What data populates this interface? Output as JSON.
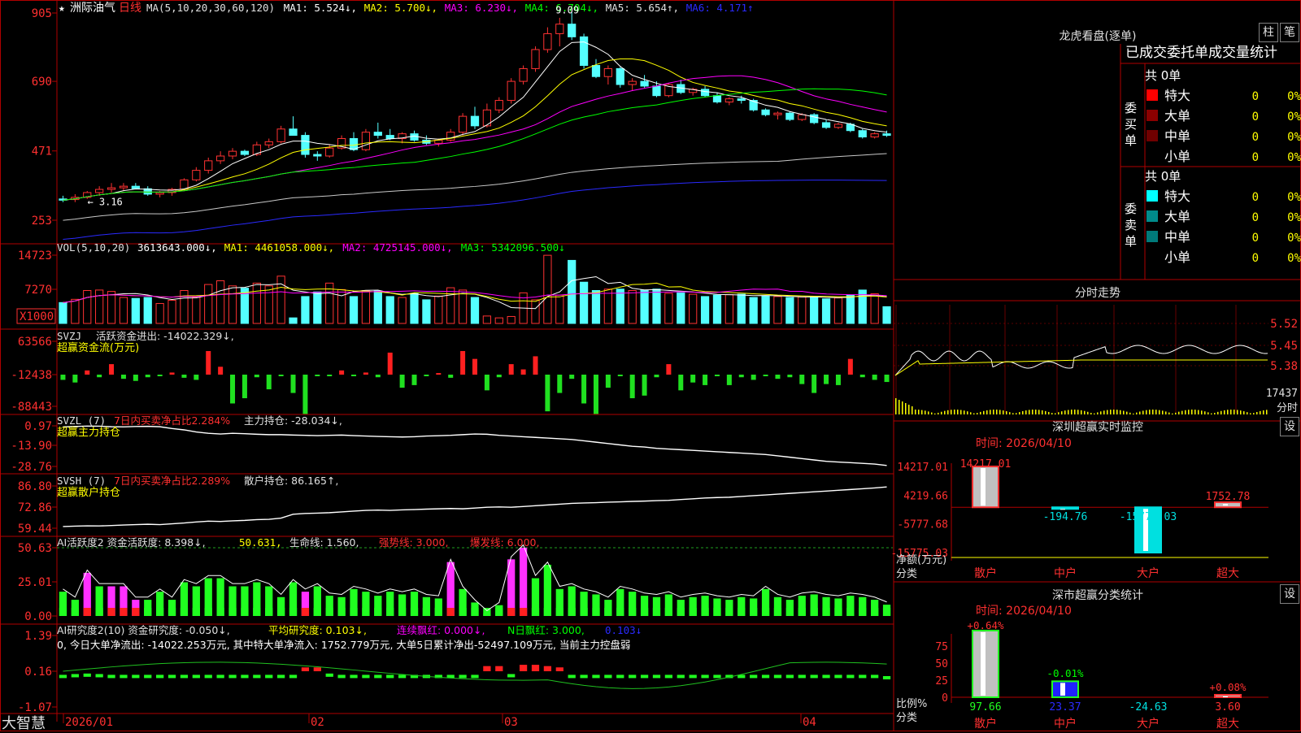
{
  "stock": {
    "star": "★",
    "name": "洲际油气",
    "period": "日线"
  },
  "ma_line": [
    {
      "t": "MA(5,10,20,30,60,120)",
      "c": "#e0e0e0"
    },
    {
      "t": "MA1: 5.524↓,",
      "c": "#ffffff"
    },
    {
      "t": "MA2: 5.700↓,",
      "c": "#ffff00"
    },
    {
      "t": "MA3: 6.230↓,",
      "c": "#ff00ff"
    },
    {
      "t": "MA4: 6.704↓,",
      "c": "#00ff00"
    },
    {
      "t": "MA5: 5.654↑,",
      "c": "#e0e0e0"
    },
    {
      "t": "MA6: 4.171↑",
      "c": "#2a2aff"
    }
  ],
  "price_axis": [
    "905",
    "690",
    "471",
    "253"
  ],
  "price_marks": {
    "high": "9.09",
    "low": "3.16"
  },
  "vol_line": [
    {
      "t": "VOL(5,10,20)",
      "c": "#e0e0e0"
    },
    {
      "t": "3613643.000↓,",
      "c": "#ffffff"
    },
    {
      "t": "MA1: 4461058.000↓,",
      "c": "#ffff00"
    },
    {
      "t": "MA2: 4725145.000↓,",
      "c": "#ff00ff"
    },
    {
      "t": "MA3: 5342096.500↓",
      "c": "#00ff00"
    }
  ],
  "vol_axis": [
    "14723",
    "7270"
  ],
  "vol_unit": "X1000",
  "svzj": {
    "l1": "SVZJ",
    "l2": "活跃资金进出: -14022.329↓,",
    "l3": "超赢资金流(万元)",
    "axis": [
      "63566",
      "-12438",
      "-88443"
    ]
  },
  "svzl": {
    "l1": "SVZL (7)",
    "l2": "7日内买卖净占比2.284%",
    "l3": "主力持仓: -28.034↓,",
    "l4": "超赢主力持仓",
    "axis": [
      "0.97",
      "-13.90",
      "-28.76"
    ]
  },
  "svsh": {
    "l1": "SVSH (7)",
    "l2": "7日内买卖净占比2.289%",
    "l3": "散户持仓: 86.165↑,",
    "l4": "超赢散户持仓",
    "axis": [
      "86.80",
      "72.86",
      "59.44"
    ]
  },
  "ai1": {
    "l1": "AI活跃度2 资金活跃度: 8.398↓,",
    "l2": "50.631,",
    "l3": "生命线: 1.560,",
    "l4": "强势线: 3.000,",
    "l5": "爆发线: 6.000,",
    "axis": [
      "50.63",
      "25.01",
      "0.00"
    ]
  },
  "ai2": {
    "l1": "AI研究度2(10) 资金研究度: -0.050↓,",
    "l2": "平均研究度: 0.103↓,",
    "l3": "连续飘红: 0.000↓,",
    "l4": "N日飘红: 3.000,",
    "l5": "0.103↓",
    "note": "0, 今日大单净流出: -14022.253万元, 其中特大单净流入: 1752.779万元, 大单5日累计净出-52497.109万元, 当前主力控盘弱",
    "axis": [
      "1.39",
      "0.16",
      "-1.07"
    ]
  },
  "date_axis": [
    "2026/01",
    "02",
    "03",
    "04"
  ],
  "logo": "大智慧",
  "lhb": {
    "title": "龙虎看盘(逐单)",
    "btn1": "柱",
    "btn2": "笔",
    "header": "已成交委托单成交量统计",
    "buy": {
      "side": "委买单",
      "count": "共 0单",
      "rows": [
        {
          "n": "特大",
          "v": "0",
          "p": "0%",
          "c": "#ff0000"
        },
        {
          "n": "大单",
          "v": "0",
          "p": "0%",
          "c": "#8b0000"
        },
        {
          "n": "中单",
          "v": "0",
          "p": "0%",
          "c": "#700000"
        },
        {
          "n": "小单",
          "v": "0",
          "p": "0%",
          "c": ""
        }
      ]
    },
    "sell": {
      "side": "委卖单",
      "count": "共 0单",
      "rows": [
        {
          "n": "特大",
          "v": "0",
          "p": "0%",
          "c": "#00ffff"
        },
        {
          "n": "大单",
          "v": "0",
          "p": "0%",
          "c": "#008b8b"
        },
        {
          "n": "中单",
          "v": "0",
          "p": "0%",
          "c": "#007a7a"
        },
        {
          "n": "小单",
          "v": "0",
          "p": "0%",
          "c": ""
        }
      ]
    }
  },
  "intraday": {
    "title": "分时走势",
    "axis": [
      "5.52",
      "5.45",
      "5.38"
    ],
    "vol": "17437",
    "vol_unit": "分时"
  },
  "monitor": {
    "title": "深圳超赢实时监控",
    "btn": "设",
    "time": "时间: 2026/04/10",
    "axis": [
      "14217.01",
      "4219.66",
      "-5777.68",
      "-15775.03"
    ],
    "unit1": "净额(万元)",
    "unit2": "分类",
    "cats": [
      "散户",
      "中户",
      "大户",
      "超大"
    ],
    "labels": [
      "14217.01",
      "-194.76",
      "-15775.03",
      "1752.78"
    ]
  },
  "stats": {
    "title": "深市超赢分类统计",
    "btn": "设",
    "time": "时间: 2026/04/10",
    "axis": [
      "75",
      "50",
      "25",
      "0"
    ],
    "unit1": "比例%",
    "unit2": "分类",
    "cats": [
      "散户",
      "中户",
      "大户",
      "超大"
    ],
    "top": [
      "+0.64%",
      "-0.01%",
      "",
      "+0.08%"
    ],
    "bottom": [
      "97.66",
      "23.37",
      "-24.63",
      "3.60"
    ]
  },
  "chart_data": [
    {
      "type": "candlestick",
      "title": "洲际油气 日线",
      "ylim": [
        2.53,
        9.05
      ],
      "x_ticks": [
        "2026/01",
        "02",
        "03",
        "04"
      ],
      "ohlc": [
        [
          3.2,
          3.3,
          3.1,
          3.16
        ],
        [
          3.18,
          3.35,
          3.1,
          3.25
        ],
        [
          3.25,
          3.45,
          3.2,
          3.4
        ],
        [
          3.4,
          3.6,
          3.3,
          3.5
        ],
        [
          3.5,
          3.7,
          3.4,
          3.55
        ],
        [
          3.55,
          3.7,
          3.45,
          3.6
        ],
        [
          3.6,
          3.7,
          3.5,
          3.52
        ],
        [
          3.52,
          3.6,
          3.3,
          3.35
        ],
        [
          3.35,
          3.45,
          3.25,
          3.4
        ],
        [
          3.4,
          3.55,
          3.3,
          3.5
        ],
        [
          3.5,
          3.85,
          3.45,
          3.8
        ],
        [
          3.8,
          4.2,
          3.75,
          4.1
        ],
        [
          4.1,
          4.5,
          4.0,
          4.4
        ],
        [
          4.4,
          4.7,
          4.3,
          4.55
        ],
        [
          4.55,
          4.8,
          4.45,
          4.7
        ],
        [
          4.7,
          4.75,
          4.55,
          4.6
        ],
        [
          4.6,
          5.0,
          4.55,
          4.9
        ],
        [
          4.9,
          5.1,
          4.8,
          5.0
        ],
        [
          5.0,
          5.5,
          4.95,
          5.4
        ],
        [
          5.4,
          5.8,
          5.3,
          5.2
        ],
        [
          5.2,
          5.3,
          4.5,
          4.6
        ],
        [
          4.6,
          4.7,
          4.4,
          4.55
        ],
        [
          4.55,
          4.9,
          4.5,
          4.8
        ],
        [
          4.8,
          5.2,
          4.75,
          5.1
        ],
        [
          5.1,
          5.3,
          4.7,
          4.75
        ],
        [
          4.75,
          5.4,
          4.7,
          5.3
        ],
        [
          5.3,
          5.6,
          5.1,
          5.2
        ],
        [
          5.2,
          5.4,
          5.05,
          5.1
        ],
        [
          5.1,
          5.3,
          4.95,
          5.25
        ],
        [
          5.25,
          5.35,
          5.0,
          5.05
        ],
        [
          5.05,
          5.2,
          4.9,
          4.95
        ],
        [
          4.95,
          5.1,
          4.85,
          5.05
        ],
        [
          5.05,
          5.4,
          5.0,
          5.3
        ],
        [
          5.3,
          5.9,
          5.2,
          5.8
        ],
        [
          5.8,
          6.1,
          5.4,
          5.5
        ],
        [
          5.5,
          6.2,
          5.45,
          6.0
        ],
        [
          6.0,
          6.4,
          5.9,
          6.3
        ],
        [
          6.3,
          7.0,
          6.2,
          6.9
        ],
        [
          6.9,
          7.4,
          6.8,
          7.3
        ],
        [
          7.3,
          8.0,
          7.2,
          7.9
        ],
        [
          7.9,
          8.6,
          7.8,
          8.4
        ],
        [
          8.4,
          8.9,
          8.0,
          8.7
        ],
        [
          8.7,
          9.09,
          8.2,
          8.3
        ],
        [
          8.3,
          8.4,
          7.3,
          7.4
        ],
        [
          7.4,
          7.6,
          7.0,
          7.05
        ],
        [
          7.05,
          7.4,
          6.8,
          7.3
        ],
        [
          7.3,
          7.35,
          6.7,
          6.8
        ],
        [
          6.8,
          7.0,
          6.6,
          6.9
        ],
        [
          6.9,
          7.1,
          6.7,
          6.75
        ],
        [
          6.75,
          6.9,
          6.4,
          6.45
        ],
        [
          6.45,
          6.85,
          6.4,
          6.8
        ],
        [
          6.8,
          6.95,
          6.5,
          6.55
        ],
        [
          6.55,
          6.7,
          6.45,
          6.65
        ],
        [
          6.65,
          6.75,
          6.4,
          6.45
        ],
        [
          6.45,
          6.55,
          6.2,
          6.25
        ],
        [
          6.25,
          6.4,
          6.15,
          6.35
        ],
        [
          6.35,
          6.45,
          6.2,
          6.3
        ],
        [
          6.3,
          6.35,
          5.95,
          6.0
        ],
        [
          6.0,
          6.05,
          5.8,
          5.85
        ],
        [
          5.85,
          5.95,
          5.7,
          5.9
        ],
        [
          5.9,
          5.95,
          5.65,
          5.7
        ],
        [
          5.7,
          5.9,
          5.65,
          5.85
        ],
        [
          5.85,
          5.9,
          5.55,
          5.6
        ],
        [
          5.6,
          5.7,
          5.4,
          5.45
        ],
        [
          5.45,
          5.6,
          5.4,
          5.55
        ],
        [
          5.55,
          5.6,
          5.3,
          5.35
        ],
        [
          5.35,
          5.4,
          5.1,
          5.15
        ],
        [
          5.15,
          5.3,
          5.1,
          5.25
        ],
        [
          5.25,
          5.35,
          5.15,
          5.2
        ]
      ]
    },
    {
      "type": "bar",
      "title": "VOL",
      "ylim": [
        0,
        14723
      ],
      "unit": "X1000",
      "values": [
        4500,
        5200,
        7100,
        7200,
        6900,
        5600,
        5400,
        5600,
        4300,
        5000,
        7100,
        5600,
        8400,
        9200,
        8100,
        7600,
        8700,
        8100,
        10200,
        1200,
        5800,
        6800,
        8700,
        7300,
        5800,
        7100,
        7000,
        5800,
        5600,
        6500,
        5100,
        5900,
        7700,
        7200,
        5600,
        1600,
        1200,
        1500,
        6600,
        5100,
        14700,
        6100,
        13600,
        8900,
        7100,
        7400,
        7400,
        7100,
        7200,
        7400,
        6500,
        6600,
        6300,
        5800,
        6100,
        6200,
        6300,
        5600,
        5900,
        5800,
        5600,
        5700,
        5700,
        5300,
        5500,
        6100,
        7200,
        6400,
        3613
      ]
    },
    {
      "type": "bar",
      "title": "SVZJ",
      "unit": "万元",
      "ylim": [
        -88443,
        63566
      ],
      "values": [
        -10000,
        -15000,
        8000,
        -5000,
        20000,
        -8000,
        -12000,
        -5000,
        -3000,
        4000,
        -6000,
        -10000,
        45000,
        15000,
        -55000,
        -45000,
        -5000,
        -28000,
        -3000,
        -35000,
        -75000,
        -1000,
        -1000,
        8000,
        -3000,
        4000,
        -5000,
        42000,
        -25000,
        -20000,
        -3000,
        3000,
        -6000,
        45000,
        30000,
        -30000,
        -5000,
        20000,
        10000,
        35000,
        -70000,
        -35000,
        -8000,
        -55000,
        -75000,
        -25000,
        -3000,
        -45000,
        -40000,
        -5000,
        20000,
        -30000,
        -15000,
        -20000,
        -3000,
        -20000,
        -5000,
        -10000,
        -3000,
        -8000,
        -5000,
        -18000,
        -35000,
        -18000,
        -20000,
        30000,
        -5000,
        -10000,
        -14022
      ]
    },
    {
      "type": "line",
      "title": "SVZL 主力持仓",
      "ylim": [
        -28.76,
        0.97
      ],
      "values": [
        0.2,
        0.5,
        0.8,
        0.7,
        0.3,
        0.2,
        0.5,
        0.6,
        0.3,
        -1.0,
        -2.0,
        -3.5,
        -4.5,
        -5.0,
        -4.5,
        -4.8,
        -5.2,
        -5.5,
        -5.5,
        -5.8,
        -6.0,
        -6.2,
        -6.0,
        -5.8,
        -6.2,
        -6.5,
        -6.8,
        -7.0,
        -7.2,
        -7.0,
        -6.5,
        -6.3,
        -6.0,
        -5.5,
        -5.0,
        -5.2,
        -6.0,
        -6.5,
        -7.0,
        -7.5,
        -8.0,
        -8.5,
        -9.0,
        -10.0,
        -11.0,
        -12.0,
        -13.0,
        -14.0,
        -14.5,
        -15.5,
        -16.0,
        -16.5,
        -17.0,
        -17.5,
        -18.0,
        -18.5,
        -19.0,
        -19.5,
        -20.0,
        -21.0,
        -22.0,
        -23.0,
        -24.0,
        -25.0,
        -25.5,
        -26.0,
        -26.5,
        -27.0,
        -28.034
      ]
    },
    {
      "type": "line",
      "title": "SVSH 散户持仓",
      "ylim": [
        59.44,
        86.8
      ],
      "values": [
        60.5,
        60.8,
        61.0,
        60.9,
        61.2,
        61.5,
        61.8,
        62.0,
        61.8,
        62.3,
        62.8,
        63.5,
        64.0,
        63.8,
        64.2,
        64.5,
        65.0,
        65.2,
        66.0,
        68.5,
        69.0,
        69.2,
        69.5,
        70.0,
        70.5,
        71.0,
        71.2,
        71.0,
        71.3,
        71.5,
        71.8,
        72.0,
        72.2,
        72.0,
        72.5,
        73.0,
        73.2,
        73.0,
        73.5,
        74.0,
        74.5,
        75.0,
        75.5,
        75.8,
        76.0,
        76.3,
        76.5,
        76.8,
        77.0,
        77.3,
        77.5,
        78.0,
        78.5,
        79.0,
        79.3,
        79.5,
        80.0,
        80.5,
        81.0,
        81.5,
        82.0,
        82.5,
        83.0,
        83.5,
        84.0,
        84.5,
        85.0,
        85.5,
        86.165
      ]
    },
    {
      "type": "bar",
      "title": "AI活跃度2",
      "ylim": [
        0,
        50.63
      ],
      "values": [
        18,
        12,
        32,
        22,
        22,
        22,
        12,
        12,
        18,
        12,
        25,
        22,
        28,
        28,
        22,
        22,
        25,
        22,
        14,
        25,
        18,
        22,
        15,
        14,
        20,
        18,
        15,
        18,
        16,
        18,
        14,
        13,
        40,
        20,
        10,
        2,
        8,
        42,
        50.631,
        28,
        38,
        20,
        22,
        18,
        16,
        12,
        20,
        18,
        15,
        14,
        16,
        12,
        14,
        15,
        13,
        12,
        14,
        13,
        20,
        14,
        12,
        15,
        16,
        14,
        13,
        15,
        14,
        12,
        8.398
      ]
    },
    {
      "type": "bar",
      "title": "AI研究度2",
      "ylim": [
        -1.07,
        1.39
      ],
      "values": [
        0.05,
        0.08,
        0.1,
        0.08,
        0.05,
        0.05,
        0.05,
        0.05,
        0.05,
        0.05,
        0.05,
        0.05,
        0.05,
        0.05,
        0.05,
        0.05,
        0.05,
        0.05,
        0.05,
        0.05,
        0.15,
        0.15,
        0.1,
        0.05,
        0.05,
        0.05,
        0.05,
        0.05,
        0.05,
        0.05,
        0.05,
        0.05,
        0.05,
        0.05,
        0.05,
        0.2,
        0.2,
        0.08,
        0.25,
        0.25,
        0.2,
        0.15,
        0.05,
        0.05,
        0.05,
        0.05,
        0.05,
        0.05,
        0.05,
        0.05,
        0.05,
        0.05,
        0.05,
        0.05,
        0.05,
        0.05,
        0.05,
        0.05,
        0.05,
        0.05,
        0.05,
        0.05,
        0.05,
        0.05,
        0.05,
        0.05,
        0.05,
        0.05,
        -0.05
      ]
    },
    {
      "type": "bar",
      "title": "深圳超赢实时监控",
      "categories": [
        "散户",
        "中户",
        "大户",
        "超大"
      ],
      "values": [
        14217.01,
        -194.76,
        -15775.03,
        1752.78
      ],
      "ylim": [
        -15775.03,
        14217.01
      ]
    },
    {
      "type": "bar",
      "title": "深市超赢分类统计",
      "categories": [
        "散户",
        "中户",
        "大户",
        "超大"
      ],
      "values": [
        97.66,
        23.37,
        -24.63,
        3.6
      ],
      "changes": [
        "+0.64%",
        "-0.01%",
        "",
        "+0.08%"
      ],
      "ylim": [
        0,
        75
      ]
    }
  ]
}
